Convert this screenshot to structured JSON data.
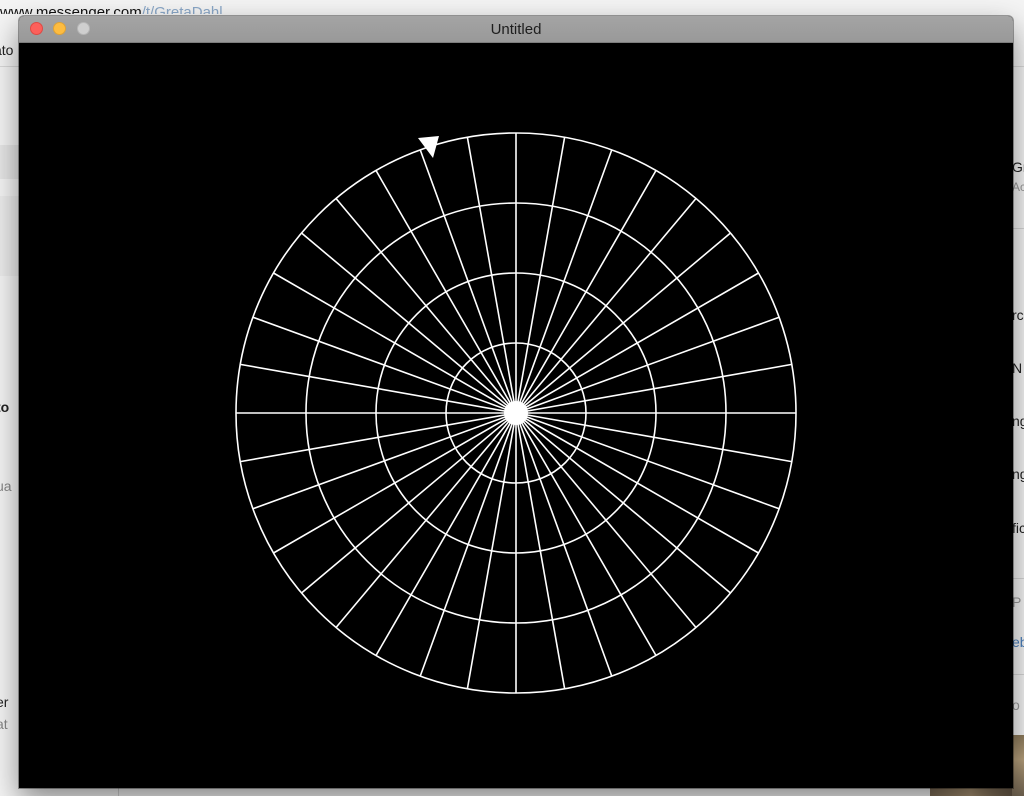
{
  "background": {
    "url_prefix": "www.messenger.com",
    "url_path": "/t/GretaDahl",
    "left_fragments": [
      "to",
      "ua",
      "er",
      "at"
    ],
    "right_fragments": [
      "Gr",
      "Ac",
      "rc",
      "N",
      "ng",
      "ng",
      "fic",
      "P",
      "eb",
      "o"
    ]
  },
  "window": {
    "title": "Untitled",
    "controls": {
      "close": "close",
      "minimize": "minimize",
      "zoom": "zoom"
    }
  },
  "polar_grid": {
    "rings": 4,
    "spokes": 36,
    "line_color": "#ffffff",
    "background_color": "#000000",
    "center_dot_color": "#ffffff",
    "marker": "triangle-marker"
  }
}
